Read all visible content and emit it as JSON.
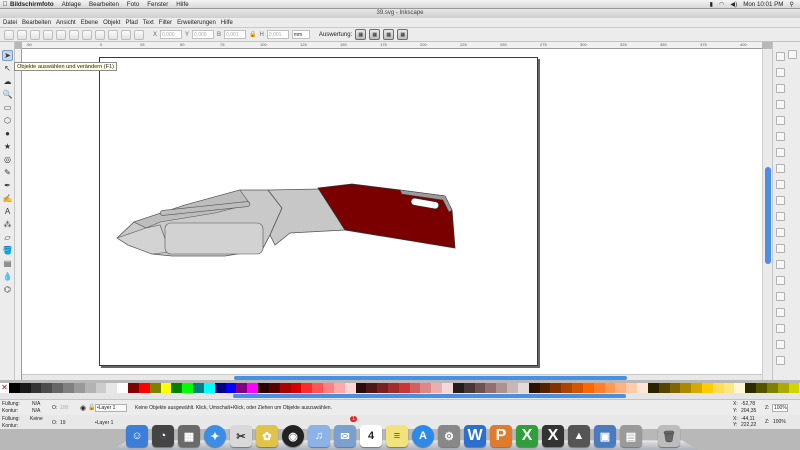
{
  "menubar": {
    "apple": "",
    "items": [
      "Bildschirmfoto",
      "Ablage",
      "Bearbeiten",
      "Foto",
      "Fenster",
      "Hilfe"
    ],
    "clock": "Mon 10:01 PM"
  },
  "window": {
    "title": "39.svg - Inkscape"
  },
  "appmenu": {
    "items": [
      "Datei",
      "Bearbeiten",
      "Ansicht",
      "Ebene",
      "Objekt",
      "Pfad",
      "Text",
      "Filter",
      "Erweiterungen",
      "Hilfe"
    ]
  },
  "controls": {
    "x_label": "X",
    "x_value": "0,000",
    "y_label": "Y",
    "y_value": "0,000",
    "w_label": "B",
    "w_value": "0,001",
    "h_label": "H",
    "h_value": "0,001",
    "unit": "mm",
    "align_label": "Auswertung:"
  },
  "ruler": {
    "ticks": [
      "-50",
      "0",
      "25",
      "50",
      "75",
      "100",
      "125",
      "150",
      "175",
      "200",
      "225",
      "250",
      "275",
      "300",
      "325",
      "350",
      "375",
      "400"
    ]
  },
  "tooltip": "Objekte auswählen und verändern (F1)",
  "palette": {
    "colors": [
      "#000000",
      "#1a1a1a",
      "#333333",
      "#4d4d4d",
      "#666666",
      "#808080",
      "#999999",
      "#b3b3b3",
      "#cccccc",
      "#e6e6e6",
      "#ffffff",
      "#800000",
      "#ff0000",
      "#808000",
      "#ffff00",
      "#008000",
      "#00ff00",
      "#008080",
      "#00ffff",
      "#000080",
      "#0000ff",
      "#800080",
      "#ff00ff",
      "#2b0000",
      "#550000",
      "#aa0000",
      "#d40000",
      "#ff2a2a",
      "#ff5555",
      "#ff8080",
      "#ffaaaa",
      "#ffd5d5",
      "#280b0b",
      "#501616",
      "#782121",
      "#a02c2c",
      "#c83737",
      "#d35f5f",
      "#de8787",
      "#e9afaf",
      "#f4d7d7",
      "#241c1c",
      "#483737",
      "#6c5353",
      "#916f6f",
      "#ac9393",
      "#c8b7b7",
      "#e3dbdb",
      "#2b1100",
      "#552200",
      "#803300",
      "#aa4400",
      "#d45500",
      "#ff6600",
      "#ff7f2a",
      "#ff9955",
      "#ffb380",
      "#ffccaa",
      "#ffe6d5",
      "#2b2200",
      "#554400",
      "#806600",
      "#aa8800",
      "#d4aa00",
      "#ffcc00",
      "#ffdd55",
      "#ffe680",
      "#fff6d5",
      "#2b2b00",
      "#555500",
      "#808000",
      "#aaaa00",
      "#d4d400"
    ]
  },
  "statusbar": {
    "fill_label": "Füllung:",
    "fill_value": "N/A",
    "stroke_label": "Kontur:",
    "stroke_value": "N/A",
    "opacity_label": "O:",
    "opacity_value": "100",
    "layer": "•Layer 1",
    "message": "Keine Objekte ausgewählt. Klick, Umschalt+Klick, oder Ziehen um Objekte auszuwählen.",
    "x_label": "X:",
    "x_value": "-52,78",
    "y_label": "Y:",
    "y_value": "204,35",
    "z_label": "Z:",
    "z_value": "100%"
  },
  "statusbar2": {
    "fill_label": "Füllung:",
    "fill_value": "Keine",
    "stroke_label": "Kontur:",
    "opacity_label": "O:",
    "opacity_value": "19",
    "layer": "•Layer 1",
    "message": "Keine Objekte ausgewählt. Klick, Umschalt+Klick, oder Ziehen um Objekte auszuwählen.",
    "x_label": "X:",
    "x_value": "-44,11",
    "y_label": "Y:",
    "y_value": "222,22",
    "z_label": "Z:",
    "z_value": "100%"
  },
  "dock": {
    "calendar_day": "4",
    "badge": "1",
    "icons": [
      "finder-icon",
      "dashboard-icon",
      "app-store-icon",
      "safari-icon",
      "photo-icon",
      "preview-icon",
      "camera-icon",
      "itunes-icon",
      "mail-icon",
      "calendar-icon",
      "notes-icon",
      "store-icon",
      "system-preferences-icon",
      "word-icon",
      "powerpoint-icon",
      "excel-icon",
      "x11-icon",
      "inkscape-icon",
      "keynote-icon",
      "finder-window-icon",
      "trash-icon"
    ]
  }
}
